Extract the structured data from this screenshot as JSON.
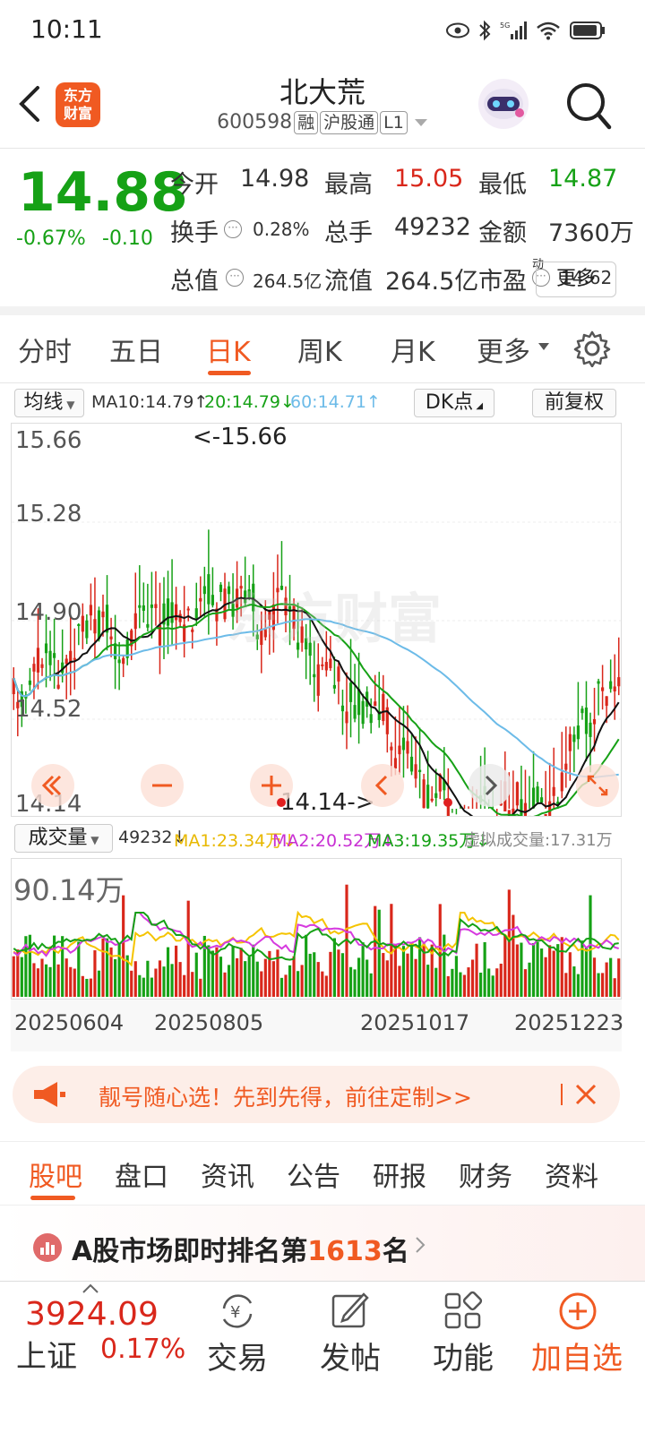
{
  "status_bar": {
    "time": "10:11"
  },
  "header": {
    "stock_name": "北大荒",
    "stock_code": "600598",
    "tags": [
      "融",
      "沪股通",
      "L1"
    ],
    "logo_text_1": "东方",
    "logo_text_2": "财富"
  },
  "quote": {
    "price": "14.88",
    "change_pct": "-0.67%",
    "change": "-0.10",
    "rows": [
      [
        {
          "label": "今开",
          "value": "14.98",
          "color": "#333333"
        },
        {
          "label": "最高",
          "value": "15.05",
          "color": "#d9271b"
        },
        {
          "label": "最低",
          "value": "14.87",
          "color": "#16a116"
        }
      ],
      [
        {
          "label": "换手",
          "value": "0.28%",
          "color": "#333333"
        },
        {
          "label": "总手",
          "value": "49232",
          "color": "#333333"
        },
        {
          "label": "金额",
          "value": "7360万",
          "color": "#333333"
        }
      ],
      [
        {
          "label": "总值",
          "value": "264.5亿",
          "color": "#333333"
        },
        {
          "label": "流值",
          "value": "264.5亿",
          "color": "#333333"
        },
        {
          "label": "市盈",
          "value": "14.62",
          "color": "#333333",
          "sup": "动"
        }
      ]
    ],
    "more_label": "更多"
  },
  "tabs": [
    "分时",
    "五日",
    "日K",
    "周K",
    "月K",
    "更多"
  ],
  "active_tab": 2,
  "ma_bar": {
    "selector": "均线",
    "ma10": "MA10:14.79↑",
    "ma20": "20:14.79↓",
    "ma60": "60:14.71↑",
    "dk_label": "DK点",
    "adjust_label": "前复权"
  },
  "kline": {
    "y_labels": [
      "15.66",
      "15.28",
      "14.90",
      "14.52",
      "14.14"
    ],
    "high_marker": "<-15.66",
    "low_marker": "14.14->",
    "watermark": "东方财富"
  },
  "volume_bar": {
    "selector": "成交量",
    "vol": "49232↓",
    "ma1": "MA1:23.34万↓",
    "ma2": "MA2:20.52万↓",
    "ma3": "MA3:19.35万↓",
    "virtual": "虚拟成交量:17.31万",
    "max_label": "90.14万"
  },
  "dates": [
    "20250604",
    "20250805",
    "20251017",
    "20251223"
  ],
  "promo": {
    "text": "靓号随心选！先到先得，前往定制>>"
  },
  "subtabs": [
    "股吧",
    "盘口",
    "资讯",
    "公告",
    "研报",
    "财务",
    "资料"
  ],
  "active_subtab": 0,
  "rank": {
    "prefix": "A股市场即时排名第",
    "number": "1613",
    "suffix": "名"
  },
  "bottom": {
    "index_value": "3924.09",
    "index_name": "上证",
    "index_change": "0.17%",
    "trade": "交易",
    "post": "发帖",
    "func": "功能",
    "add": "加自选"
  },
  "colors": {
    "accent": "#f05a22",
    "up": "#d9271b",
    "down": "#16a116",
    "ma10": "#111111",
    "ma20": "#16a116",
    "ma60": "#6cbbe8",
    "vma1": "#f5c400",
    "vma2": "#d63adf"
  }
}
